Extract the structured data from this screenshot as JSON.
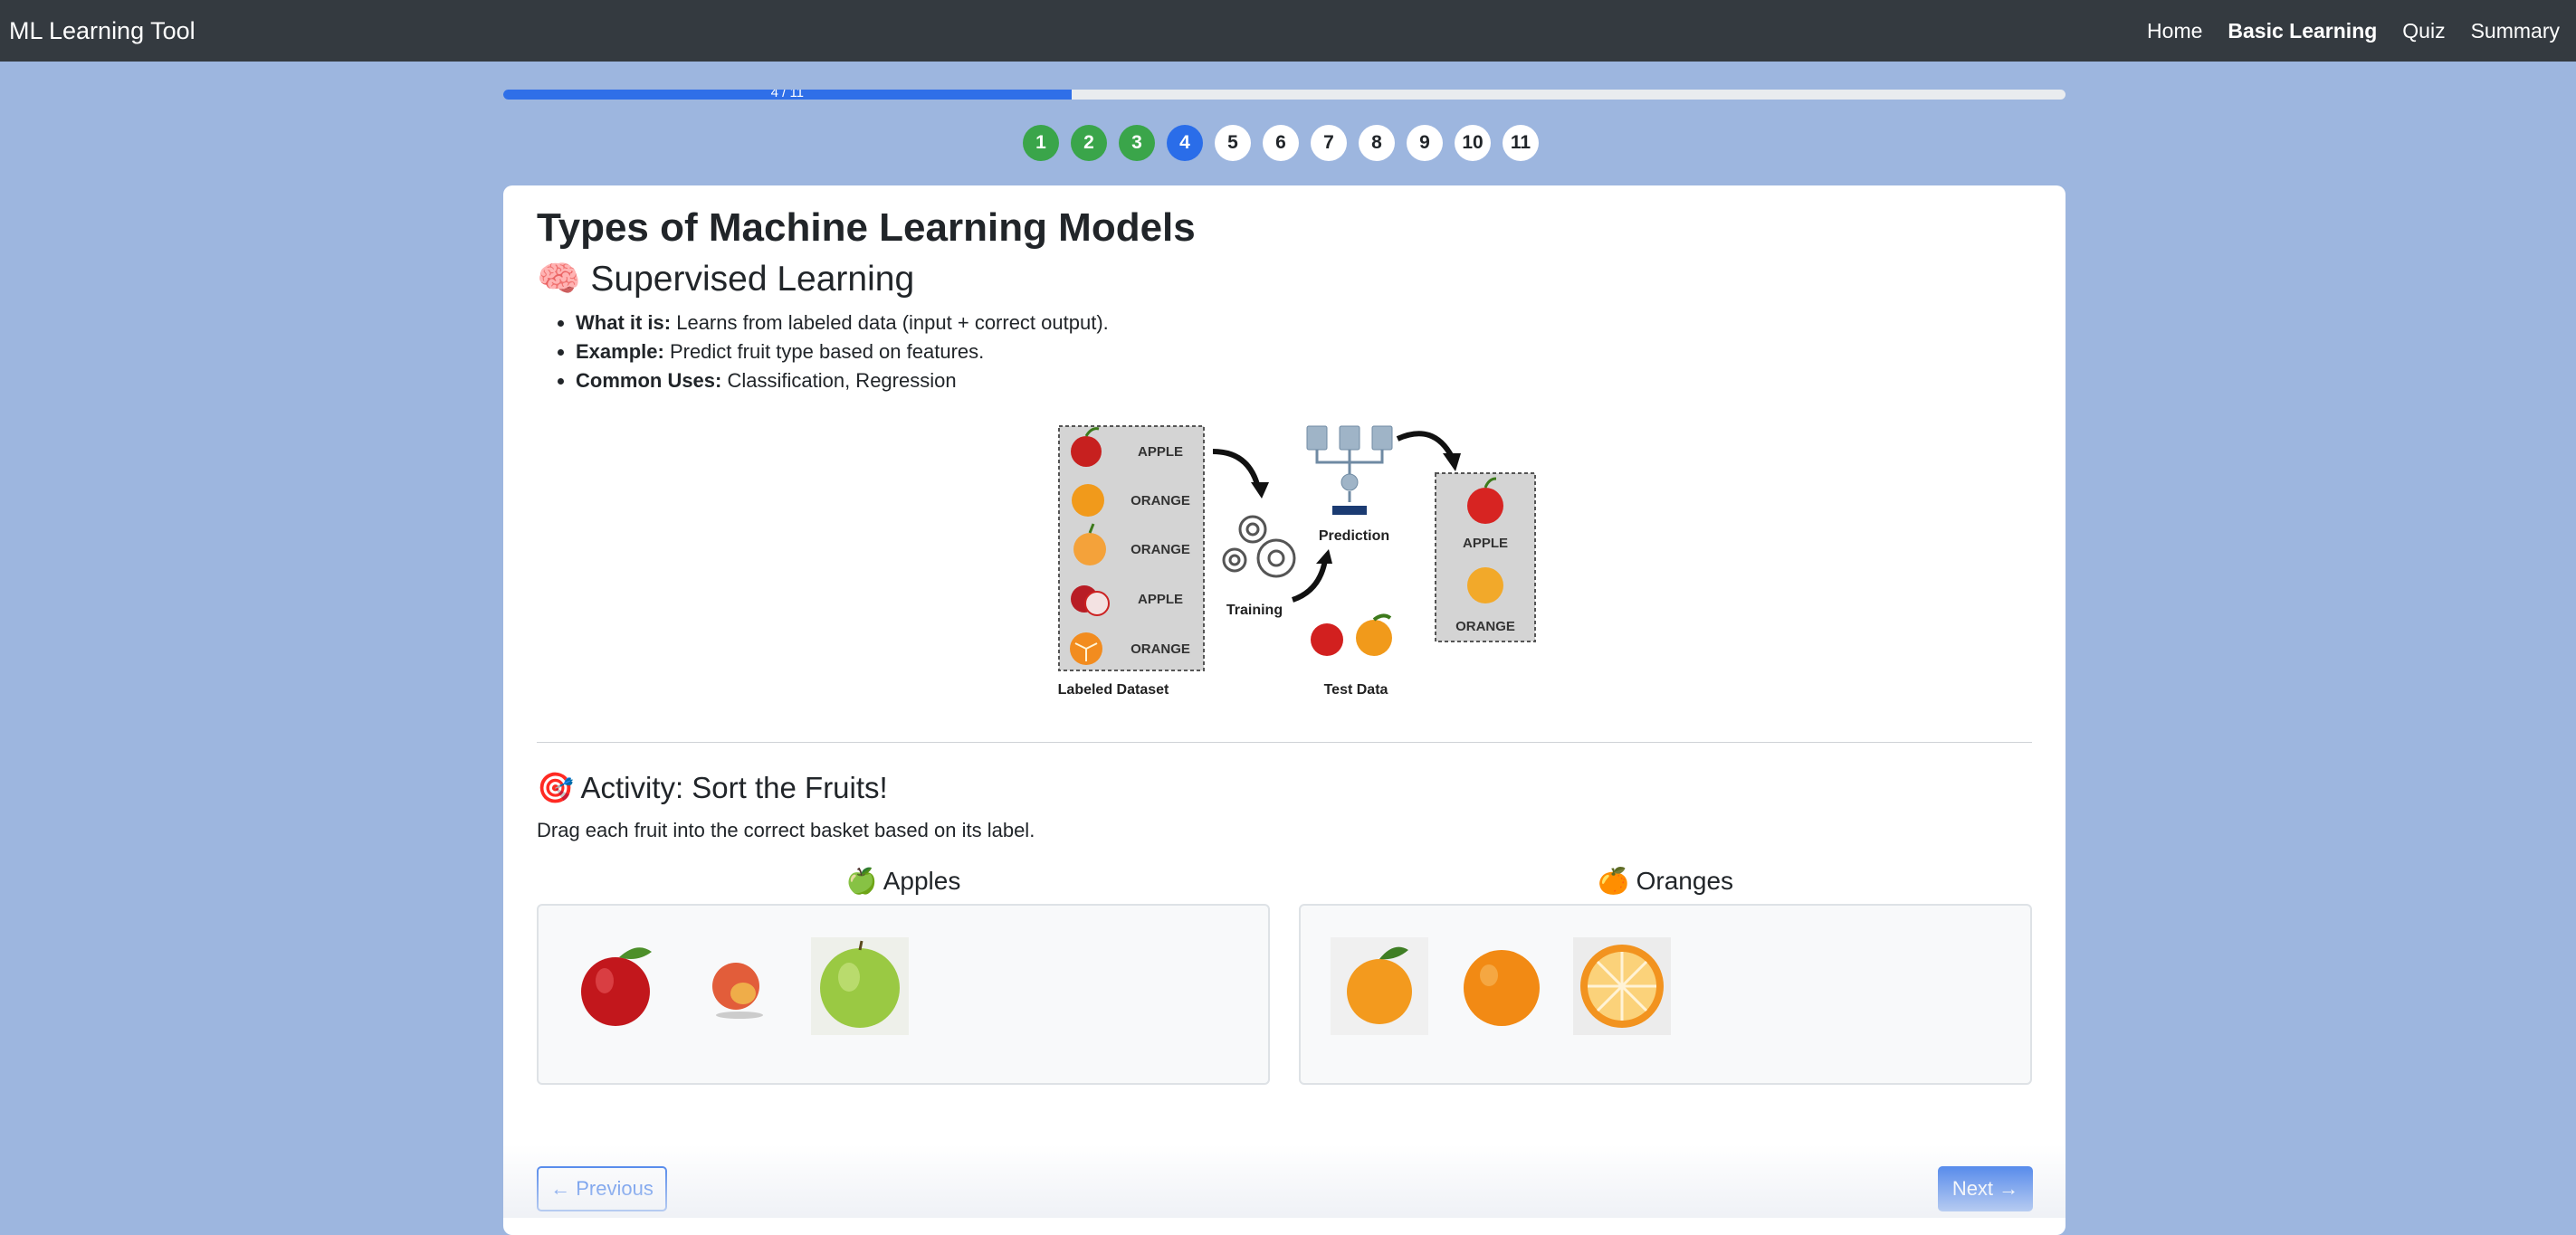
{
  "navbar": {
    "brand": "ML Learning Tool",
    "links": [
      "Home",
      "Basic Learning",
      "Quiz",
      "Summary"
    ],
    "active": "Basic Learning"
  },
  "progress": {
    "text": "4 / 11",
    "current": 4,
    "total": 11
  },
  "steps": [
    "1",
    "2",
    "3",
    "4",
    "5",
    "6",
    "7",
    "8",
    "9",
    "10",
    "11"
  ],
  "content": {
    "title": "Types of Machine Learning Models",
    "section_icon": "🧠",
    "section_title": "Supervised Learning",
    "bullets": [
      {
        "label": "What it is:",
        "text": " Learns from labeled data (input + correct output)."
      },
      {
        "label": "Example:",
        "text": " Predict fruit type based on features."
      },
      {
        "label": "Common Uses:",
        "text": " Classification, Regression"
      }
    ],
    "diagram": {
      "dataset_labels": [
        "APPLE",
        "ORANGE",
        "ORANGE",
        "APPLE",
        "ORANGE"
      ],
      "dataset_caption": "Labeled Dataset",
      "training_label": "Training",
      "prediction_label": "Prediction",
      "test_label": "Test Data",
      "output_labels": [
        "APPLE",
        "ORANGE"
      ]
    },
    "activity_icon": "🎯",
    "activity_title": "Activity: Sort the Fruits!",
    "activity_desc": "Drag each fruit into the correct basket based on its label.",
    "baskets": [
      {
        "icon": "🍏",
        "title": "Apples"
      },
      {
        "icon": "🍊",
        "title": "Oranges"
      }
    ]
  },
  "buttons": {
    "previous": "← Previous",
    "next": "Next →"
  },
  "colors": {
    "navbar": "#343a40",
    "primary": "#2a6de9",
    "done": "#3aa54a",
    "background": "#9db6df"
  }
}
